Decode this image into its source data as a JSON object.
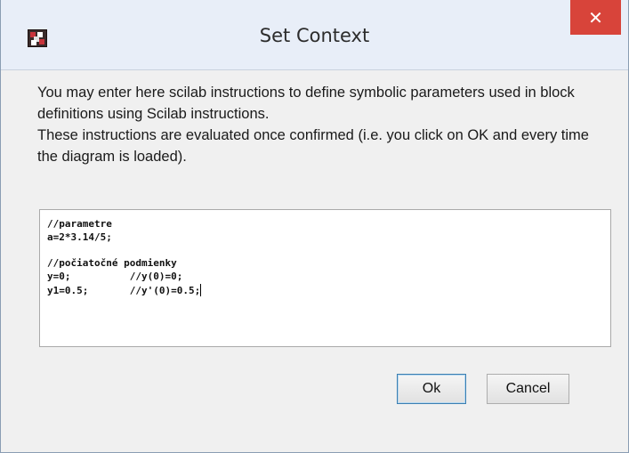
{
  "window": {
    "title": "Set Context",
    "close_label": "✕",
    "icon": "scilab-xcos-icon"
  },
  "description": {
    "lines": [
      "You may enter here scilab instructions to define symbolic parameters used in block definitions using Scilab instructions.",
      "These instructions are evaluated once confirmed (i.e. you click on OK and every time the diagram is loaded)."
    ]
  },
  "editor": {
    "lines": [
      "//parametre",
      "a=2*3.14/5;",
      "",
      "//počiatočné podmienky",
      "y=0;          //y(0)=0;",
      "y1=0.5;       //y'(0)=0.5;"
    ]
  },
  "buttons": {
    "ok_label": "Ok",
    "cancel_label": "Cancel"
  },
  "colors": {
    "close_button": "#d8443a",
    "titlebar": "#e8eef8",
    "dialog_background": "#f0f0f0"
  }
}
